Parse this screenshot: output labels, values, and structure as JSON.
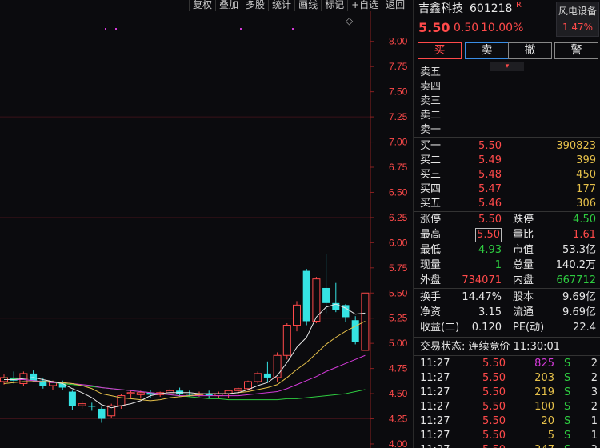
{
  "toolbar": [
    "复权",
    "叠加",
    "多股",
    "统计",
    "画线",
    "标记",
    "+自选",
    "返回"
  ],
  "stock": {
    "name": "吉鑫科技",
    "code": "601218",
    "flag": "R",
    "price": "5.50",
    "change": "0.50",
    "pct": "10.00%",
    "sector": "风电设备",
    "sector_pct": "1.47%"
  },
  "actions": {
    "buy": "买",
    "sell": "卖",
    "cancel": "撤",
    "alert": "警"
  },
  "colors": {
    "up": "#ff4a4a",
    "down": "#2ecc40",
    "flat": "#e6e6e6",
    "volume": "#e5c04a",
    "ma5": "#e6e6e6",
    "ma10": "#e5c04a",
    "ma20": "#d33ad8",
    "ma60": "#2ecc40",
    "candle_down": "#35e3e3"
  },
  "orderbook": {
    "sell": [
      {
        "label": "卖五"
      },
      {
        "label": "卖四"
      },
      {
        "label": "卖三"
      },
      {
        "label": "卖二"
      },
      {
        "label": "卖一"
      }
    ],
    "buy": [
      {
        "label": "买一",
        "price": "5.50",
        "vol": "390823"
      },
      {
        "label": "买二",
        "price": "5.49",
        "vol": "399"
      },
      {
        "label": "买三",
        "price": "5.48",
        "vol": "450"
      },
      {
        "label": "买四",
        "price": "5.47",
        "vol": "177"
      },
      {
        "label": "买五",
        "price": "5.46",
        "vol": "306"
      }
    ]
  },
  "stats1": [
    {
      "l1": "涨停",
      "v1": "5.50",
      "c1": "red",
      "l2": "跌停",
      "v2": "4.50",
      "c2": "green"
    },
    {
      "l1": "最高",
      "v1": "5.50",
      "c1": "red",
      "l2": "量比",
      "v2": "1.61",
      "c2": "red"
    },
    {
      "l1": "最低",
      "v1": "4.93",
      "c1": "green",
      "l2": "市值",
      "v2": "53.3亿",
      "c2": "white"
    },
    {
      "l1": "现量",
      "v1": "1",
      "c1": "green",
      "l2": "总量",
      "v2": "140.2万",
      "c2": "white"
    },
    {
      "l1": "外盘",
      "v1": "734071",
      "c1": "red",
      "l2": "内盘",
      "v2": "667712",
      "c2": "green"
    }
  ],
  "stats2": [
    {
      "l1": "换手",
      "v1": "14.47%",
      "l2": "股本",
      "v2": "9.69亿"
    },
    {
      "l1": "净资",
      "v1": "3.15",
      "l2": "流通",
      "v2": "9.69亿"
    },
    {
      "l1": "收益(二)",
      "v1": "0.120",
      "l2": "PE(动)",
      "v2": "22.4"
    }
  ],
  "status": "交易状态: 连续竞价 11:30:01",
  "ticks": [
    {
      "time": "11:27",
      "price": "5.50",
      "vol": "825",
      "side": "S",
      "n": "2",
      "vc": "purple"
    },
    {
      "time": "11:27",
      "price": "5.50",
      "vol": "203",
      "side": "S",
      "n": "2",
      "vc": "yellow"
    },
    {
      "time": "11:27",
      "price": "5.50",
      "vol": "219",
      "side": "S",
      "n": "3",
      "vc": "yellow"
    },
    {
      "time": "11:27",
      "price": "5.50",
      "vol": "100",
      "side": "S",
      "n": "2",
      "vc": "yellow"
    },
    {
      "time": "11:27",
      "price": "5.50",
      "vol": "20",
      "side": "S",
      "n": "1",
      "vc": "yellow"
    },
    {
      "time": "11:27",
      "price": "5.50",
      "vol": "5",
      "side": "S",
      "n": "1",
      "vc": "yellow"
    },
    {
      "time": "11:27",
      "price": "5.50",
      "vol": "247",
      "side": "S",
      "n": "2",
      "vc": "yellow"
    }
  ],
  "chart_data": {
    "type": "candlestick",
    "yticks": [
      "8.00",
      "7.75",
      "7.50",
      "7.25",
      "7.00",
      "6.75",
      "6.50",
      "6.25",
      "6.00",
      "5.75",
      "5.50",
      "5.25",
      "5.00",
      "4.75",
      "4.50",
      "4.25",
      "4.00"
    ],
    "ylim": [
      3.96,
      8.3
    ],
    "candles": [
      [
        4.62,
        4.69,
        4.59,
        4.66
      ],
      [
        4.66,
        4.72,
        4.6,
        4.63
      ],
      [
        4.6,
        4.72,
        4.58,
        4.7
      ],
      [
        4.7,
        4.73,
        4.62,
        4.63
      ],
      [
        4.63,
        4.66,
        4.55,
        4.58
      ],
      [
        4.58,
        4.63,
        4.54,
        4.61
      ],
      [
        4.61,
        4.63,
        4.54,
        4.56
      ],
      [
        4.52,
        4.53,
        4.34,
        4.38
      ],
      [
        4.38,
        4.43,
        4.35,
        4.4
      ],
      [
        4.38,
        4.41,
        4.33,
        4.37
      ],
      [
        4.35,
        4.37,
        4.21,
        4.25
      ],
      [
        4.28,
        4.4,
        4.26,
        4.38
      ],
      [
        4.38,
        4.5,
        4.35,
        4.48
      ],
      [
        4.5,
        4.53,
        4.45,
        4.51
      ],
      [
        4.49,
        4.53,
        4.45,
        4.51
      ],
      [
        4.51,
        4.54,
        4.46,
        4.49
      ],
      [
        4.49,
        4.52,
        4.47,
        4.51
      ],
      [
        4.51,
        4.55,
        4.49,
        4.53
      ],
      [
        4.53,
        4.56,
        4.47,
        4.5
      ],
      [
        4.5,
        4.53,
        4.47,
        4.49
      ],
      [
        4.49,
        4.52,
        4.47,
        4.5
      ],
      [
        4.5,
        4.53,
        4.46,
        4.48
      ],
      [
        4.48,
        4.52,
        4.46,
        4.5
      ],
      [
        4.5,
        4.54,
        4.46,
        4.53
      ],
      [
        4.53,
        4.56,
        4.49,
        4.55
      ],
      [
        4.55,
        4.63,
        4.53,
        4.62
      ],
      [
        4.62,
        4.72,
        4.6,
        4.7
      ],
      [
        4.7,
        4.82,
        4.61,
        4.66
      ],
      [
        4.66,
        4.91,
        4.62,
        4.88
      ],
      [
        4.88,
        5.2,
        4.84,
        5.18
      ],
      [
        5.18,
        5.42,
        5.12,
        5.38
      ],
      [
        5.72,
        5.74,
        5.18,
        5.22
      ],
      [
        5.22,
        5.66,
        5.2,
        5.64
      ],
      [
        5.55,
        5.89,
        5.3,
        5.4
      ],
      [
        5.4,
        5.6,
        5.31,
        5.33
      ],
      [
        5.38,
        5.39,
        5.21,
        5.26
      ],
      [
        5.23,
        5.27,
        4.99,
        5.01
      ],
      [
        4.93,
        5.5,
        4.93,
        5.5
      ]
    ],
    "ma5": [
      4.64,
      4.64,
      4.65,
      4.66,
      4.64,
      4.62,
      4.6,
      4.55,
      4.51,
      4.46,
      4.39,
      4.36,
      4.38,
      4.4,
      4.43,
      4.48,
      4.5,
      4.51,
      4.51,
      4.51,
      4.5,
      4.5,
      4.5,
      4.5,
      4.51,
      4.54,
      4.58,
      4.61,
      4.68,
      4.81,
      4.96,
      5.06,
      5.26,
      5.36,
      5.39,
      5.35,
      5.29,
      5.3
    ],
    "ma10": [
      4.6,
      4.61,
      4.62,
      4.62,
      4.62,
      4.62,
      4.61,
      4.6,
      4.58,
      4.55,
      4.5,
      4.48,
      4.46,
      4.45,
      4.44,
      4.43,
      4.44,
      4.46,
      4.47,
      4.48,
      4.49,
      4.5,
      4.5,
      4.5,
      4.51,
      4.52,
      4.54,
      4.56,
      4.59,
      4.66,
      4.74,
      4.81,
      4.9,
      4.99,
      5.06,
      5.12,
      5.17,
      5.22
    ],
    "ma20": [
      4.64,
      4.64,
      4.64,
      4.63,
      4.62,
      4.61,
      4.61,
      4.6,
      4.59,
      4.58,
      4.56,
      4.55,
      4.54,
      4.53,
      4.52,
      4.51,
      4.5,
      4.49,
      4.48,
      4.48,
      4.48,
      4.48,
      4.48,
      4.48,
      4.48,
      4.49,
      4.5,
      4.51,
      4.52,
      4.55,
      4.59,
      4.63,
      4.67,
      4.72,
      4.76,
      4.8,
      4.84,
      4.88
    ],
    "ma60": [
      4.66,
      4.65,
      4.64,
      4.63,
      4.62,
      4.61,
      4.6,
      4.59,
      4.58,
      4.57,
      4.56,
      4.55,
      4.54,
      4.53,
      4.52,
      4.51,
      4.5,
      4.49,
      4.48,
      4.47,
      4.46,
      4.45,
      4.45,
      4.44,
      4.44,
      4.44,
      4.44,
      4.44,
      4.44,
      4.45,
      4.45,
      4.46,
      4.47,
      4.48,
      4.49,
      4.5,
      4.52,
      4.54
    ]
  }
}
